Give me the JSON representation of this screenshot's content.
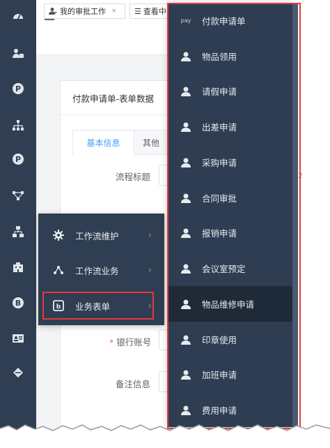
{
  "rail_icons": [
    "dashboard-icon",
    "user-lock-icon",
    "p-circle-icon",
    "org-tree-icon",
    "p-circle-icon",
    "flow-nodes-icon",
    "network-icon",
    "building-icon",
    "blog-icon",
    "id-card-icon",
    "layers-icon"
  ],
  "tabs": [
    {
      "label": "我的审批工作",
      "close": "×"
    },
    {
      "label": "查看中"
    }
  ],
  "card": {
    "title": "付款申请单-表单数据",
    "subtabs": [
      "基本信息",
      "其他"
    ]
  },
  "form": {
    "fields": [
      {
        "label": "流程标题",
        "required": false
      },
      {
        "label": "*银行账号",
        "required": true
      },
      {
        "label": "备注信息",
        "required": false
      }
    ],
    "right_fragment": "2"
  },
  "flyout": {
    "items": [
      {
        "label": "工作流维护",
        "icon": "gear-icon",
        "chevron": "›"
      },
      {
        "label": "工作流业务",
        "icon": "workflow-nodes-icon",
        "chevron": "›"
      },
      {
        "label": "业务表单",
        "icon": "b-square-icon",
        "chevron": "‹",
        "active": true
      }
    ]
  },
  "menu": {
    "items": [
      {
        "label": "付款申请单",
        "icon": "pay-icon",
        "icon_text": "pay"
      },
      {
        "label": "物品领用",
        "icon": "user-icon"
      },
      {
        "label": "请假申请",
        "icon": "user-icon"
      },
      {
        "label": "出差申请",
        "icon": "user-icon"
      },
      {
        "label": "采购申请",
        "icon": "user-icon"
      },
      {
        "label": "合同审批",
        "icon": "user-icon"
      },
      {
        "label": "报销申请",
        "icon": "user-icon"
      },
      {
        "label": "会议室预定",
        "icon": "user-icon"
      },
      {
        "label": "物品维修申请",
        "icon": "user-icon",
        "active": true
      },
      {
        "label": "印章使用",
        "icon": "user-icon"
      },
      {
        "label": "加班申请",
        "icon": "user-icon"
      },
      {
        "label": "费用申请",
        "icon": "user-icon"
      }
    ]
  },
  "colors": {
    "rail_bg": "#2f3e52",
    "menu_bg": "#2e3d51",
    "highlight_frame": "#e33a3a",
    "tab_active": "#409eff"
  }
}
